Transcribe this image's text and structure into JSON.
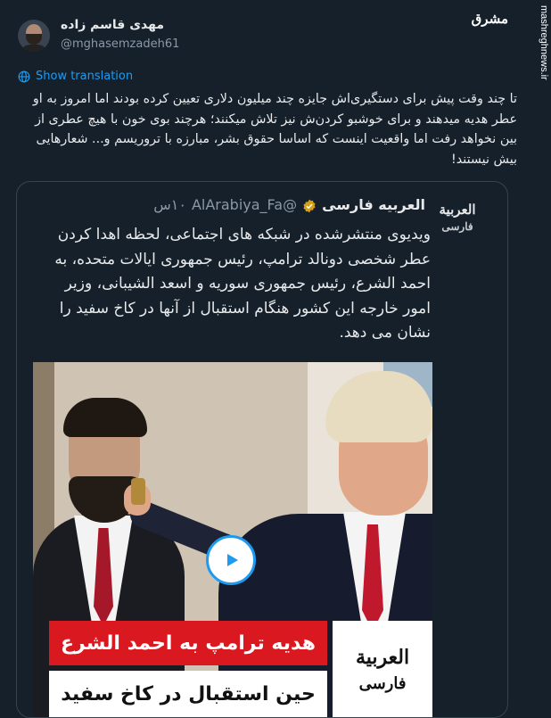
{
  "author": {
    "name": "مهدی قاسم زاده",
    "handle": "@mghasemzadeh61"
  },
  "brand": {
    "logo": "مشرق",
    "url": "mashreghnews.ir"
  },
  "show_translation": "Show translation",
  "tweet_text": "تا چند وقت پیش برای دستگیری‌اش جایزه چند میلیون دلاری تعیین کرده بودند اما امروز به او عطر هدیه میدهند و برای خوشبو کردن‌ش نیز تلاش میکنند؛ هرچند بوی خون با هیچ عطری از بین نخواهد رفت اما واقعیت اینست که اساسا حقوق بشر، مبارزه با تروریسم و... شعارهایی بیش نیستند!",
  "quoted": {
    "logo_line1": "العربية",
    "logo_line2": "فارسی",
    "name": "العربیه فارسی",
    "handle": "@AlArabiya_Fa",
    "time": "۱۰س",
    "text": "ویدیوی منتشرشده در شبکه های اجتماعی، لحظه اهدا کردن عطر شخصی دونالد ترامپ، رئیس جمهوری ایالات متحده، به احمد الشرع، رئیس جمهوری سوریه و اسعد الشیبانی، وزیر امور خارجه این کشور هنگام استقبال از آنها در کاخ سفید را نشان می دهد.",
    "banner_line1": "هدیه ترامپ به احمد الشرع",
    "banner_line2": "حین استقبال در کاخ سفید",
    "banner_logo1": "العربية",
    "banner_logo2": "فارسی"
  },
  "colors": {
    "background": "#15202b",
    "link": "#1d9bf0",
    "verified": "#d4a017",
    "banner_red": "#d9181f"
  }
}
